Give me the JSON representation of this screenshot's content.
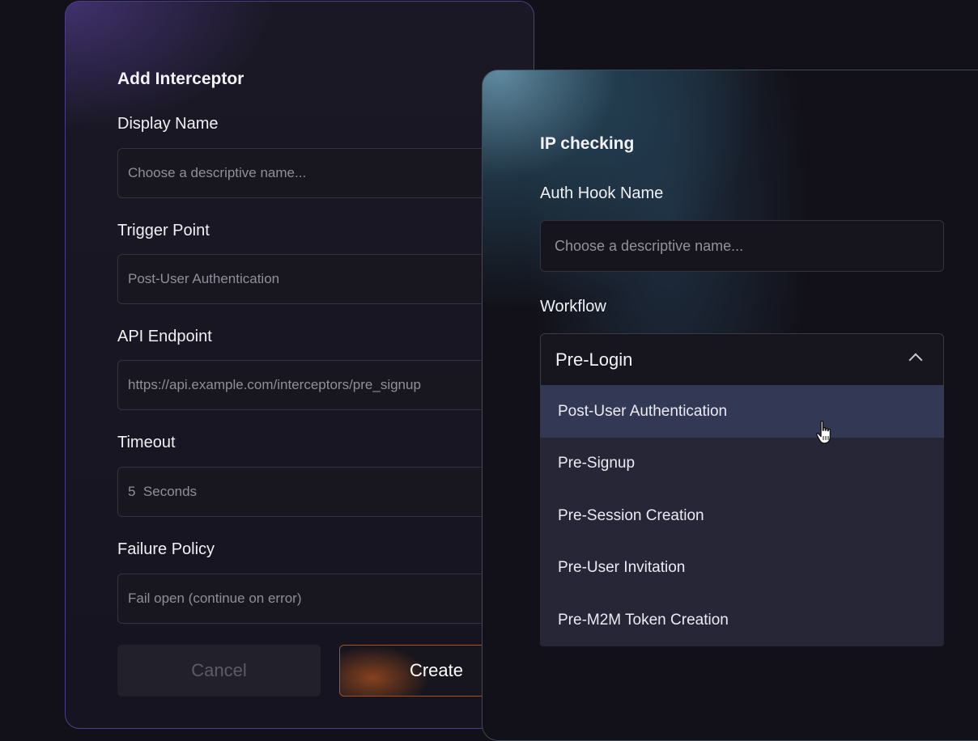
{
  "add_interceptor": {
    "title": "Add Interceptor",
    "display_name": {
      "label": "Display Name",
      "placeholder": "Choose a descriptive name..."
    },
    "trigger_point": {
      "label": "Trigger Point",
      "value": "Post-User Authentication"
    },
    "api_endpoint": {
      "label": "API Endpoint",
      "placeholder": "https://api.example.com/interceptors/pre_signup"
    },
    "timeout": {
      "label": "Timeout",
      "value": "5  Seconds"
    },
    "failure_policy": {
      "label": "Failure Policy",
      "value": "Fail open (continue on error)"
    },
    "cancel_label": "Cancel",
    "create_label": "Create"
  },
  "auth_hook": {
    "title": "IP checking",
    "name": {
      "label": "Auth Hook Name",
      "placeholder": "Choose a descriptive name..."
    },
    "workflow": {
      "label": "Workflow",
      "selected": "Pre-Login",
      "options": [
        "Post-User Authentication",
        "Pre-Signup",
        "Pre-Session Creation",
        "Pre-User Invitation",
        "Pre-M2M Token Creation"
      ],
      "highlighted": "Post-User Authentication"
    }
  },
  "icons": {
    "dropdown": "chevron-up-icon",
    "pointer": "hand-pointer-icon"
  },
  "colors": {
    "accent_purple": "#4a3f86",
    "accent_orange": "#a4521f",
    "highlight": "#333955",
    "menu_bg": "#262637"
  }
}
